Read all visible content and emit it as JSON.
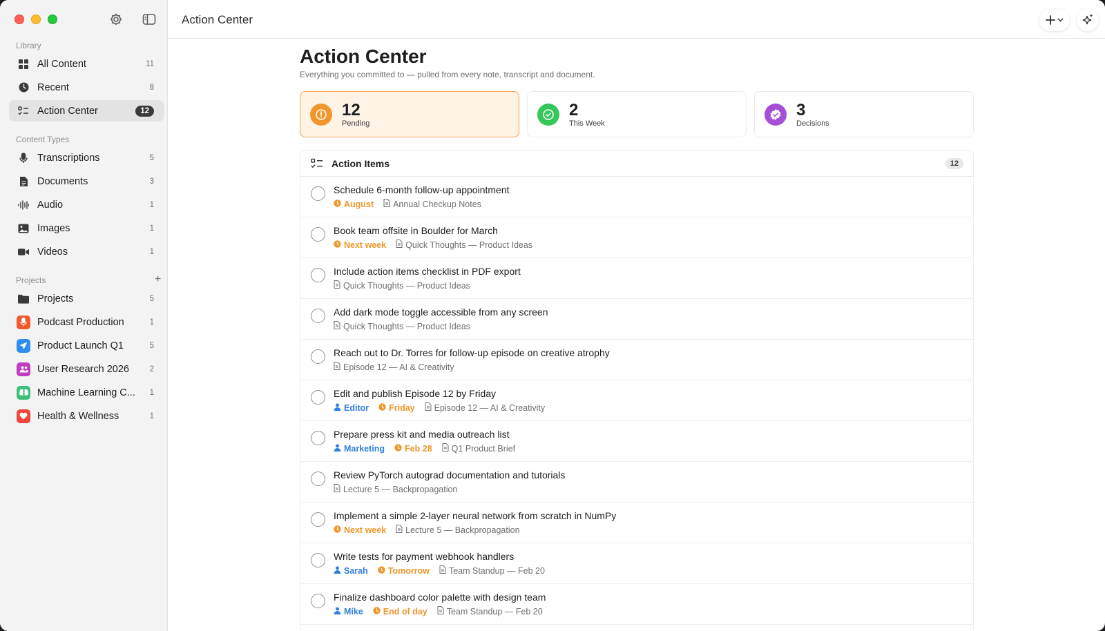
{
  "window": {
    "toolbar_title": "Action Center"
  },
  "sidebar": {
    "library_label": "Library",
    "library_items": [
      {
        "label": "All Content",
        "count": "11",
        "icon": "grid-icon"
      },
      {
        "label": "Recent",
        "count": "8",
        "icon": "clock-icon"
      },
      {
        "label": "Action Center",
        "count": "12",
        "icon": "checklist-icon"
      }
    ],
    "content_types_label": "Content Types",
    "content_items": [
      {
        "label": "Transcriptions",
        "count": "5",
        "icon": "microphone-icon"
      },
      {
        "label": "Documents",
        "count": "3",
        "icon": "document-icon"
      },
      {
        "label": "Audio",
        "count": "1",
        "icon": "waveform-icon"
      },
      {
        "label": "Images",
        "count": "1",
        "icon": "image-icon"
      },
      {
        "label": "Videos",
        "count": "1",
        "icon": "video-icon"
      }
    ],
    "projects_label": "Projects",
    "project_items": [
      {
        "label": "Projects",
        "count": "5",
        "icon": "folder-icon"
      },
      {
        "label": "Podcast Production",
        "count": "1",
        "icon": "microphone-icon",
        "color": "#f05a2c"
      },
      {
        "label": "Product Launch Q1",
        "count": "5",
        "icon": "paper-plane-icon",
        "color": "#2f8cf0"
      },
      {
        "label": "User Research 2026",
        "count": "2",
        "icon": "people-icon",
        "color": "#c03bc0"
      },
      {
        "label": "Machine Learning C...",
        "count": "1",
        "icon": "brain-icon",
        "color": "#3fbf7a"
      },
      {
        "label": "Health & Wellness",
        "count": "1",
        "icon": "heart-icon",
        "color": "#f0453c"
      }
    ]
  },
  "main": {
    "title": "Action Center",
    "subtitle": "Everything you committed to — pulled from every note, transcript and document.",
    "stats": [
      {
        "value": "12",
        "label": "Pending",
        "color": "#f0962a",
        "icon": "exclamation-icon"
      },
      {
        "value": "2",
        "label": "This Week",
        "color": "#34c759",
        "icon": "check-circle-icon"
      },
      {
        "value": "3",
        "label": "Decisions",
        "color": "#a44fd6",
        "icon": "badge-check-icon"
      }
    ],
    "panel_title": "Action Items",
    "panel_count": "12",
    "items": [
      {
        "title": "Schedule 6-month follow-up appointment",
        "assignee": "",
        "due": "August",
        "source": "Annual Checkup Notes"
      },
      {
        "title": "Book team offsite in Boulder for March",
        "assignee": "",
        "due": "Next week",
        "source": "Quick Thoughts — Product Ideas"
      },
      {
        "title": "Include action items checklist in PDF export",
        "assignee": "",
        "due": "",
        "source": "Quick Thoughts — Product Ideas"
      },
      {
        "title": "Add dark mode toggle accessible from any screen",
        "assignee": "",
        "due": "",
        "source": "Quick Thoughts — Product Ideas"
      },
      {
        "title": "Reach out to Dr. Torres for follow-up episode on creative atrophy",
        "assignee": "",
        "due": "",
        "source": "Episode 12 — AI & Creativity"
      },
      {
        "title": "Edit and publish Episode 12 by Friday",
        "assignee": "Editor",
        "due": "Friday",
        "source": "Episode 12 — AI & Creativity"
      },
      {
        "title": "Prepare press kit and media outreach list",
        "assignee": "Marketing",
        "due": "Feb 28",
        "source": "Q1 Product Brief"
      },
      {
        "title": "Review PyTorch autograd documentation and tutorials",
        "assignee": "",
        "due": "",
        "source": "Lecture 5 — Backpropagation"
      },
      {
        "title": "Implement a simple 2-layer neural network from scratch in NumPy",
        "assignee": "",
        "due": "Next week",
        "source": "Lecture 5 — Backpropagation"
      },
      {
        "title": "Write tests for payment webhook handlers",
        "assignee": "Sarah",
        "due": "Tomorrow",
        "source": "Team Standup — Feb 20"
      },
      {
        "title": "Finalize dashboard color palette with design team",
        "assignee": "Mike",
        "due": "End of day",
        "source": "Team Standup — Feb 20"
      }
    ]
  }
}
